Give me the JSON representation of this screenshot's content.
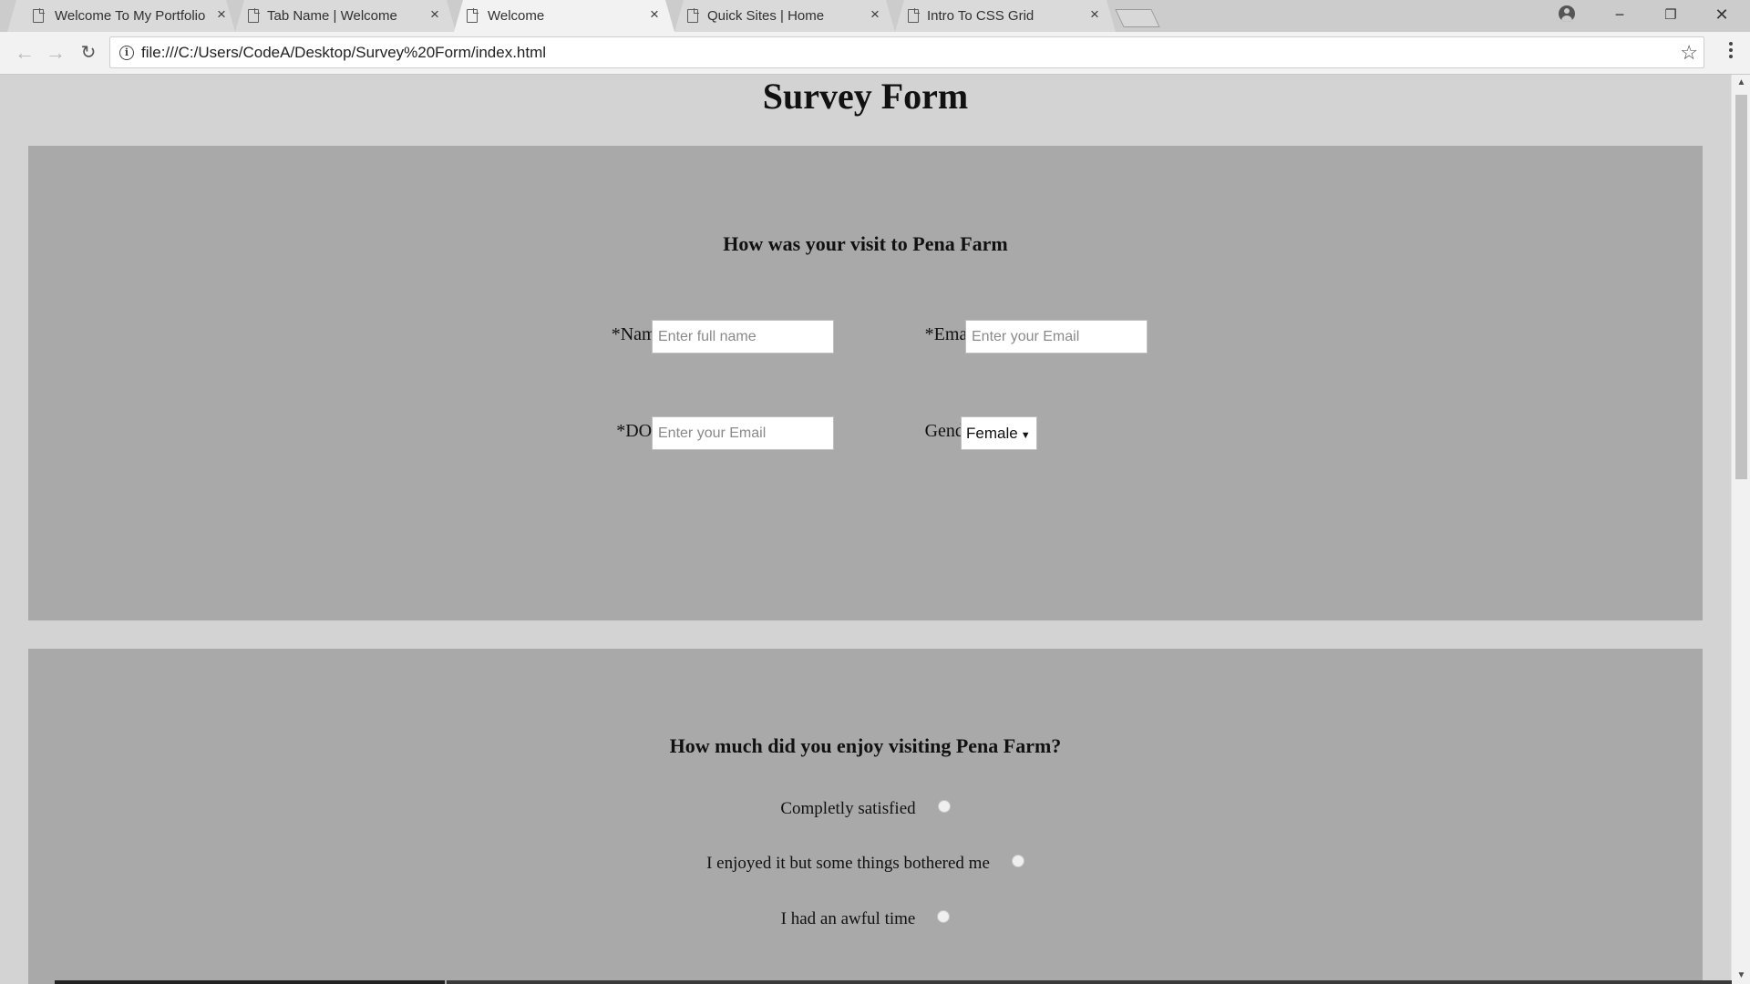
{
  "browser": {
    "tabs": [
      {
        "label": "Welcome To My Portfolio",
        "active": false
      },
      {
        "label": "Tab Name | Welcome",
        "active": false
      },
      {
        "label": "Welcome",
        "active": true
      },
      {
        "label": "Quick Sites | Home",
        "active": false
      },
      {
        "label": "Intro To CSS Grid",
        "active": false
      }
    ],
    "tab_close_glyph": "×",
    "url": "file:///C:/Users/CodeA/Desktop/Survey%20Form/index.html",
    "window_controls": {
      "minimize": "−",
      "maximize": "❐",
      "close": "✕"
    }
  },
  "page": {
    "title": "Survey Form",
    "visit_section": {
      "heading": "How was your visit to Pena Farm",
      "name_label": "*Name:",
      "name_placeholder": "Enter full name",
      "email_label": "*Email:",
      "email_placeholder": "Enter your Email",
      "dob_label": "*DOB:",
      "dob_placeholder": "Enter your Email",
      "gender_label": "Gender:",
      "gender_value": "Female"
    },
    "enjoy_section": {
      "heading": "How much did you enjoy visiting Pena Farm?",
      "options": [
        "Completly satisfied",
        "I enjoyed it but some things bothered me",
        "I had an awful time"
      ]
    }
  }
}
